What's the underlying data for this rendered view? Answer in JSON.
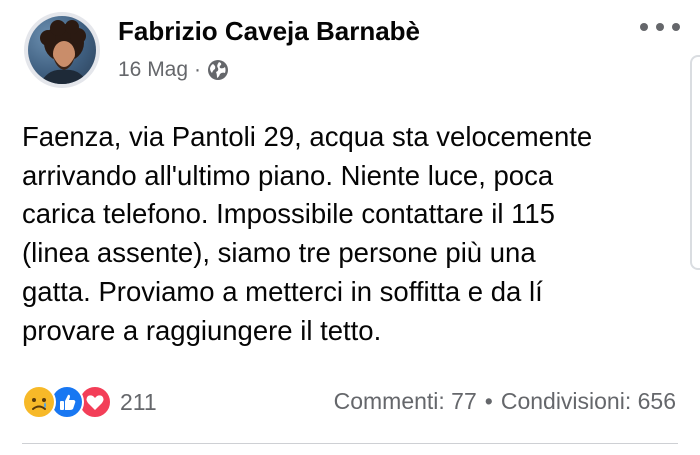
{
  "post": {
    "author": "Fabrizio Caveja Barnabè",
    "date": "16 Mag",
    "meta_separator": "·",
    "privacy_icon": "globe-icon",
    "more_icon": "more-options-icon",
    "text_lines": [
      "Faenza, via Pantoli 29, acqua sta velocemente",
      "arrivando all'ultimo piano. Niente luce, poca",
      "carica telefono. Impossibile contattare il 115",
      "(linea assente), siamo tre persone più una",
      "gatta. Proviamo a metterci in soffitta e da lí",
      "provare a raggiungere il tetto."
    ]
  },
  "reactions": {
    "icons": [
      "sad-reaction-icon",
      "like-reaction-icon",
      "love-reaction-icon"
    ],
    "count": "211"
  },
  "stats": {
    "comments": "Commenti: 77",
    "separator": "•",
    "shares": "Condivisioni: 656"
  },
  "colors": {
    "text": "#050505",
    "secondary": "#65676b",
    "like": "#1877f2",
    "love": "#f33e58",
    "sad": "#f7b928"
  }
}
